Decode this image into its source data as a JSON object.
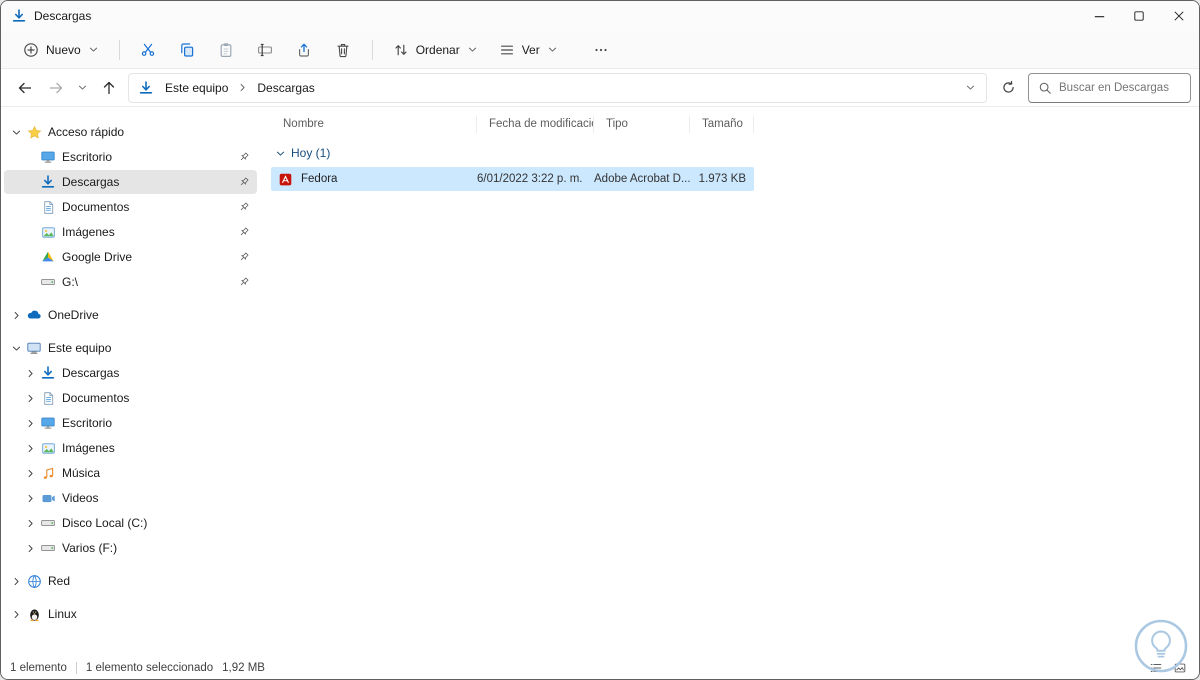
{
  "window": {
    "title": "Descargas"
  },
  "toolbar": {
    "new_label": "Nuevo",
    "sort_label": "Ordenar",
    "view_label": "Ver",
    "actions": [
      {
        "name": "cut",
        "icon": "cut-icon"
      },
      {
        "name": "copy",
        "icon": "copy-icon"
      },
      {
        "name": "paste",
        "icon": "paste-icon"
      },
      {
        "name": "rename",
        "icon": "rename-icon"
      },
      {
        "name": "share",
        "icon": "share-icon"
      },
      {
        "name": "delete",
        "icon": "delete-icon"
      }
    ]
  },
  "address": {
    "breadcrumbs": [
      "Este equipo",
      "Descargas"
    ],
    "search_placeholder": "Buscar en Descargas"
  },
  "sidebar": {
    "items": [
      {
        "label": "Acceso rápido",
        "icon": "star-icon",
        "level": 0,
        "chevron": "down"
      },
      {
        "label": "Escritorio",
        "icon": "desktop-icon",
        "level": 1,
        "chevron": "none",
        "pinned": true
      },
      {
        "label": "Descargas",
        "icon": "downloads-icon",
        "level": 1,
        "chevron": "none",
        "pinned": true,
        "selected": true
      },
      {
        "label": "Documentos",
        "icon": "documents-icon",
        "level": 1,
        "chevron": "none",
        "pinned": true
      },
      {
        "label": "Imágenes",
        "icon": "pictures-icon",
        "level": 1,
        "chevron": "none",
        "pinned": true
      },
      {
        "label": "Google Drive",
        "icon": "gdrive-icon",
        "level": 1,
        "chevron": "none",
        "pinned": true
      },
      {
        "label": "G:\\",
        "icon": "drive-icon",
        "level": 1,
        "chevron": "none",
        "pinned": true
      },
      {
        "label": "OneDrive",
        "icon": "onedrive-icon",
        "level": 0,
        "chevron": "right",
        "section_gap": true
      },
      {
        "label": "Este equipo",
        "icon": "computer-icon",
        "level": 0,
        "chevron": "down",
        "section_gap": true
      },
      {
        "label": "Descargas",
        "icon": "downloads-icon",
        "level": 1,
        "chevron": "right"
      },
      {
        "label": "Documentos",
        "icon": "documents-icon",
        "level": 1,
        "chevron": "right"
      },
      {
        "label": "Escritorio",
        "icon": "desktop-icon",
        "level": 1,
        "chevron": "right"
      },
      {
        "label": "Imágenes",
        "icon": "pictures-icon",
        "level": 1,
        "chevron": "right"
      },
      {
        "label": "Música",
        "icon": "music-icon",
        "level": 1,
        "chevron": "right"
      },
      {
        "label": "Videos",
        "icon": "videos-icon",
        "level": 1,
        "chevron": "right"
      },
      {
        "label": "Disco Local (C:)",
        "icon": "drive-icon",
        "level": 1,
        "chevron": "right"
      },
      {
        "label": "Varios (F:)",
        "icon": "drive-icon",
        "level": 1,
        "chevron": "right"
      },
      {
        "label": "Red",
        "icon": "network-icon",
        "level": 0,
        "chevron": "right",
        "section_gap": true
      },
      {
        "label": "Linux",
        "icon": "linux-icon",
        "level": 0,
        "chevron": "right",
        "section_gap": true
      }
    ]
  },
  "content": {
    "columns": [
      "Nombre",
      "Fecha de modificación",
      "Tipo",
      "Tamaño"
    ],
    "group_label": "Hoy (1)",
    "files": [
      {
        "name": "Fedora",
        "icon": "pdf-icon",
        "modified": "6/01/2022 3:22 p. m.",
        "type": "Adobe Acrobat D...",
        "size": "1.973 KB",
        "selected": true
      }
    ]
  },
  "statusbar": {
    "item_count": "1 elemento",
    "selection_count": "1 elemento seleccionado",
    "selection_size": "1,92 MB"
  },
  "colors": {
    "selection_highlight": "#cce8ff",
    "sidebar_selected": "#e5e5e5",
    "group_header_text": "#174e7e",
    "accent_blue": "#1771d6"
  }
}
